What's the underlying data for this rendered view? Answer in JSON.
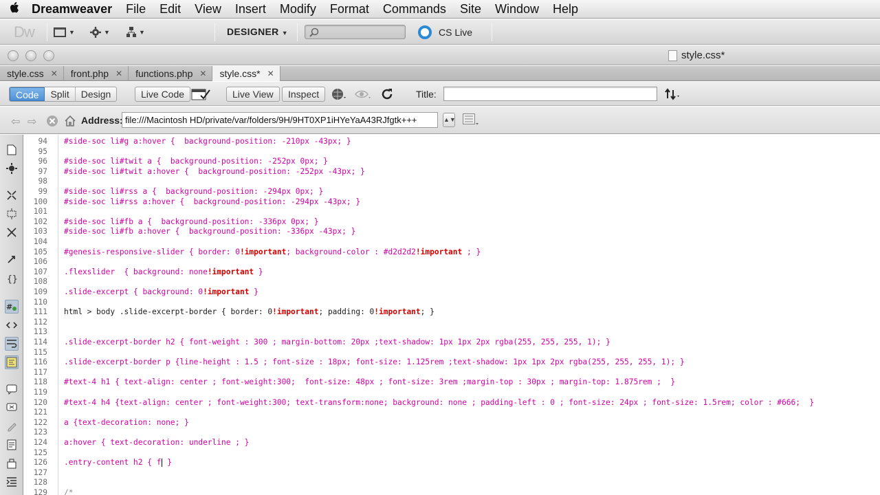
{
  "menubar": {
    "app_name": "Dreamweaver",
    "items": [
      "File",
      "Edit",
      "View",
      "Insert",
      "Modify",
      "Format",
      "Commands",
      "Site",
      "Window",
      "Help"
    ]
  },
  "appbar": {
    "logo": "Dw",
    "workspace": "DESIGNER",
    "cs_live": "CS Live",
    "accent": "#2b8ad6"
  },
  "window": {
    "title": "style.css*"
  },
  "tabs": [
    {
      "label": "style.css"
    },
    {
      "label": "front.php"
    },
    {
      "label": "functions.php"
    },
    {
      "label": "style.css*"
    }
  ],
  "doc_toolbar": {
    "code": "Code",
    "split": "Split",
    "design": "Design",
    "live_code": "Live Code",
    "live_view": "Live View",
    "inspect": "Inspect",
    "title_label": "Title:",
    "title_value": ""
  },
  "address_bar": {
    "label": "Address:",
    "value": "file:///Macintosh HD/private/var/folders/9H/9HT0XP1iHYeYaA43RJfgtk+++"
  },
  "code_lines": [
    {
      "n": "94",
      "t": "#side-soc li#g a:hover {  background-position: -210px -43px; }"
    },
    {
      "n": "95",
      "t": ""
    },
    {
      "n": "96",
      "t": "#side-soc li#twit a {  background-position: -252px 0px; }"
    },
    {
      "n": "97",
      "t": "#side-soc li#twit a:hover {  background-position: -252px -43px; }"
    },
    {
      "n": "98",
      "t": ""
    },
    {
      "n": "99",
      "t": "#side-soc li#rss a {  background-position: -294px 0px; }"
    },
    {
      "n": "100",
      "t": "#side-soc li#rss a:hover {  background-position: -294px -43px; }"
    },
    {
      "n": "101",
      "t": ""
    },
    {
      "n": "102",
      "t": "#side-soc li#fb a {  background-position: -336px 0px; }"
    },
    {
      "n": "103",
      "t": "#side-soc li#fb a:hover {  background-position: -336px -43px; }"
    },
    {
      "n": "104",
      "t": ""
    },
    {
      "n": "105",
      "t": "#genesis-responsive-slider { border: 0!important; background-color : #d2d2d2!important ; }"
    },
    {
      "n": "106",
      "t": ""
    },
    {
      "n": "107",
      "t": ".flexslider  { background: none!important }"
    },
    {
      "n": "108",
      "t": ""
    },
    {
      "n": "109",
      "t": ".slide-excerpt { background: 0!important }"
    },
    {
      "n": "110",
      "t": ""
    },
    {
      "n": "111",
      "t": "html > body .slide-excerpt-border { border: 0!important; padding: 0!important; }"
    },
    {
      "n": "112",
      "t": ""
    },
    {
      "n": "113",
      "t": ""
    },
    {
      "n": "114",
      "t": ".slide-excerpt-border h2 { font-weight : 300 ; margin-bottom: 20px ;text-shadow: 1px 1px 2px rgba(255, 255, 255, 1); }"
    },
    {
      "n": "115",
      "t": ""
    },
    {
      "n": "116",
      "t": ".slide-excerpt-border p {line-height : 1.5 ; font-size : 18px; font-size: 1.125rem ;text-shadow: 1px 1px 2px rgba(255, 255, 255, 1); }"
    },
    {
      "n": "117",
      "t": ""
    },
    {
      "n": "118",
      "t": "#text-4 h1 { text-align: center ; font-weight:300;  font-size: 48px ; font-size: 3rem ;margin-top : 30px ; margin-top: 1.875rem ;  }"
    },
    {
      "n": "119",
      "t": ""
    },
    {
      "n": "120",
      "t": "#text-4 h4 {text-align: center ; font-weight:300; text-transform:none; background: none ; padding-left : 0 ; font-size: 24px ; font-size: 1.5rem; color : #666;  }"
    },
    {
      "n": "121",
      "t": ""
    },
    {
      "n": "122",
      "t": "a {text-decoration: none; }"
    },
    {
      "n": "123",
      "t": ""
    },
    {
      "n": "124",
      "t": "a:hover { text-decoration: underline ; }"
    },
    {
      "n": "125",
      "t": ""
    },
    {
      "n": "126",
      "t": ".entry-content h2 { f }"
    },
    {
      "n": "127",
      "t": ""
    },
    {
      "n": "128",
      "t": ""
    },
    {
      "n": "129",
      "t": "/*"
    }
  ],
  "colors": {
    "selector": "#d100a6",
    "important": "#d40000",
    "line_number": "#6d6d6d"
  }
}
